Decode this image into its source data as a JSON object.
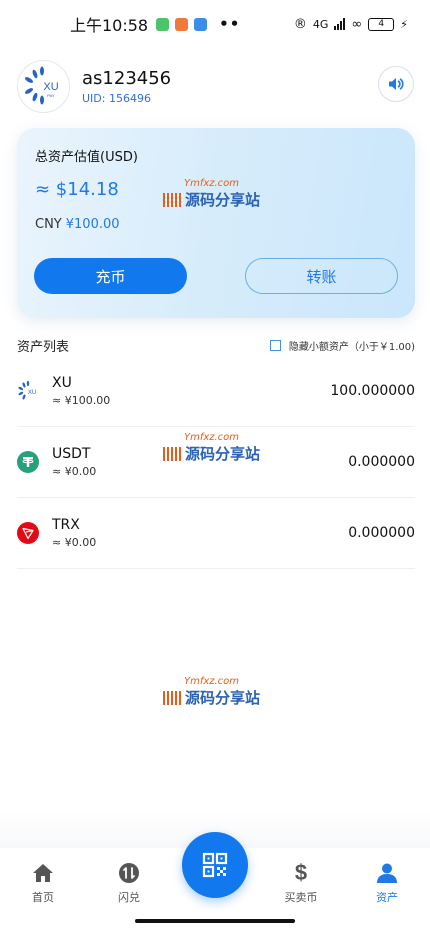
{
  "status_bar": {
    "time": "上午10:58",
    "dots": "••",
    "network": "4G",
    "battery": "4"
  },
  "profile": {
    "username": "as123456",
    "uid": "UID: 156496",
    "avatar_text": "XU",
    "avatar_sub": "PAY"
  },
  "card": {
    "title": "总资产估值(USD)",
    "usd_value": "≈ $14.18",
    "cny_label": "CNY",
    "cny_value": "¥100.00",
    "deposit_label": "充币",
    "transfer_label": "转账"
  },
  "watermark": {
    "top": "Ymfxz.com",
    "main": "源码分享站"
  },
  "list": {
    "title": "资产列表",
    "hide_small_label": "隐藏小额资产（小于￥1.00)",
    "assets": [
      {
        "name": "XU",
        "sub": "≈ ¥100.00",
        "amount": "100.000000",
        "icon": "xu-logo-icon"
      },
      {
        "name": "USDT",
        "sub": "≈ ¥0.00",
        "amount": "0.000000",
        "icon": "tether-icon"
      },
      {
        "name": "TRX",
        "sub": "≈ ¥0.00",
        "amount": "0.000000",
        "icon": "tron-icon"
      }
    ]
  },
  "nav": {
    "home": "首页",
    "flash": "闪兑",
    "trade": "买卖币",
    "assets": "资产"
  },
  "colors": {
    "primary": "#1178ee",
    "accent_text": "#1f7ae6",
    "usdt": "#26a17b",
    "trx": "#e50915"
  }
}
